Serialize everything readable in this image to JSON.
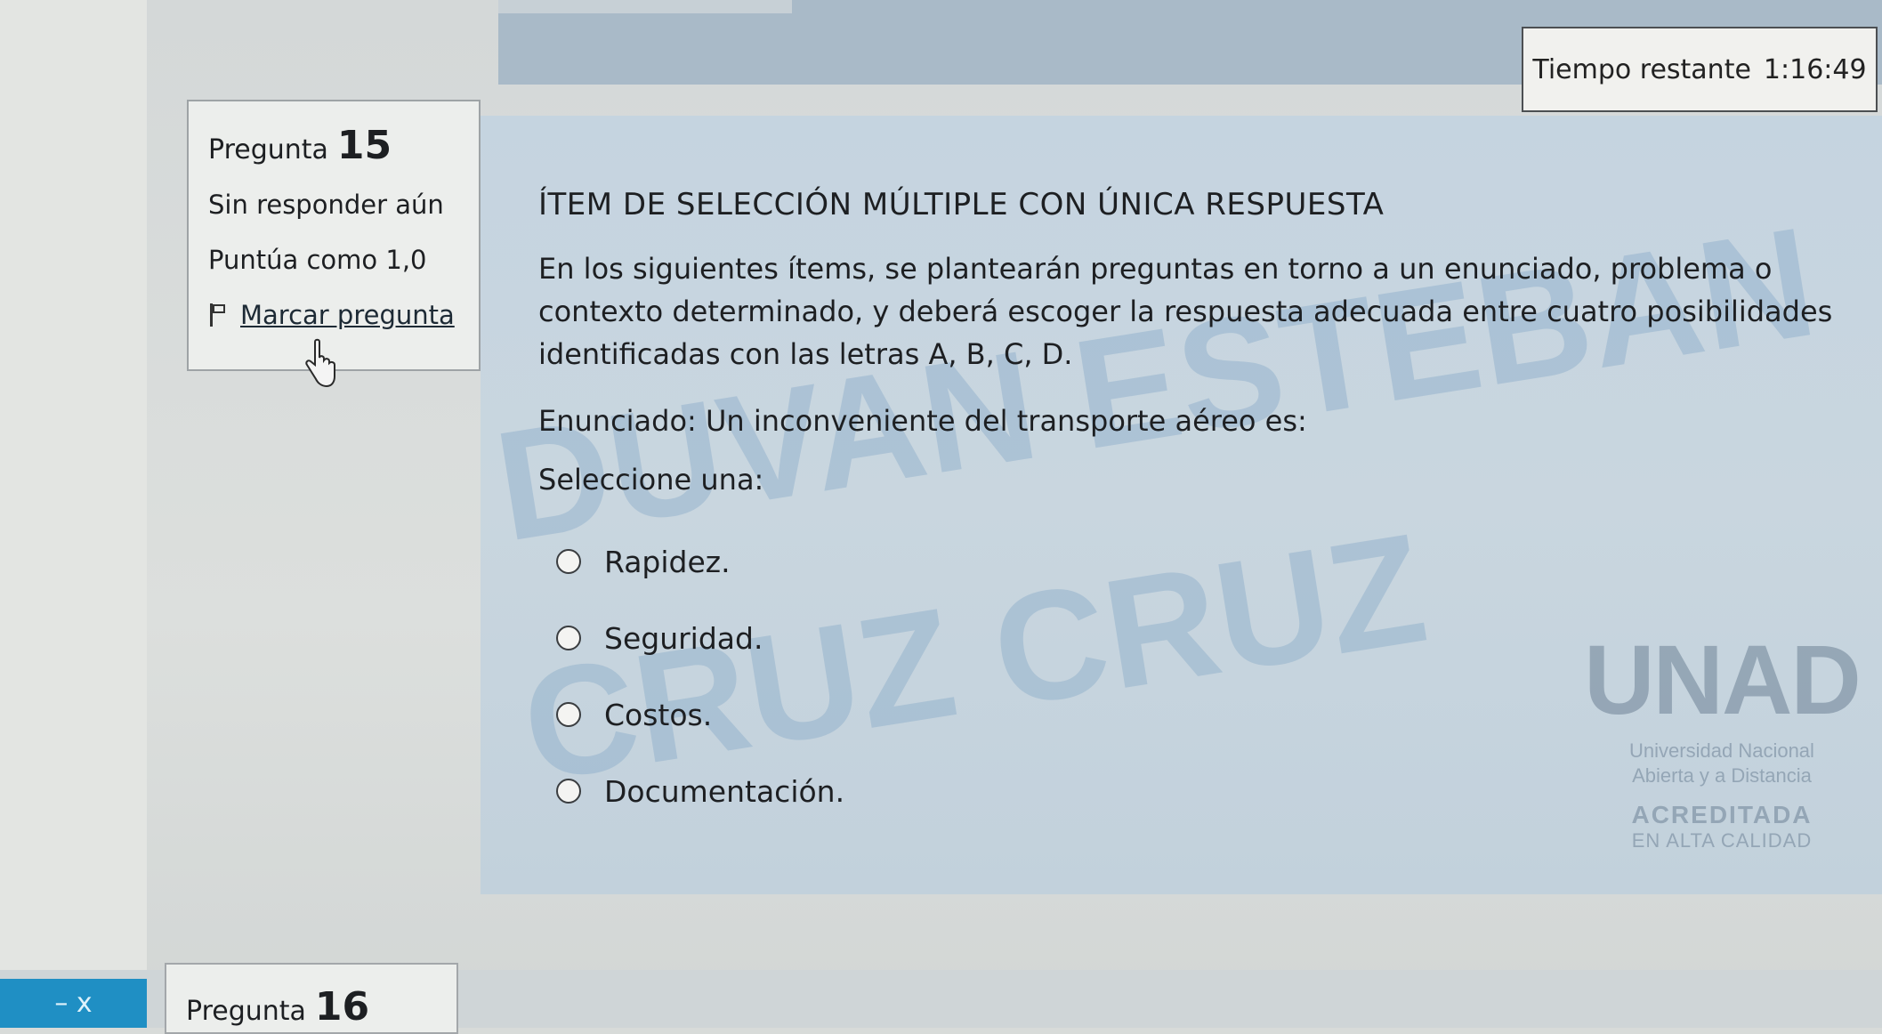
{
  "timer": {
    "label": "Tiempo restante",
    "value": "1:16:49"
  },
  "question_info": {
    "label": "Pregunta",
    "number": "15",
    "status": "Sin responder aún",
    "score": "Puntúa como 1,0",
    "flag_label": "Marcar pregunta"
  },
  "question": {
    "title": "ÍTEM DE SELECCIÓN MÚLTIPLE CON ÚNICA RESPUESTA",
    "description": "En los siguientes ítems, se plantearán preguntas en torno a un enunciado, problema o contexto determinado, y deberá escoger la respuesta adecuada entre cuatro posibilidades identificadas con las letras A, B, C, D.",
    "statement": "Enunciado: Un inconveniente del transporte aéreo es:",
    "select_prompt": "Seleccione una:",
    "options": [
      "Rapidez.",
      "Seguridad.",
      "Costos.",
      "Documentación."
    ]
  },
  "watermark": {
    "line1": "DUVAN ESTEBAN",
    "line2": "CRUZ CRUZ"
  },
  "logo": {
    "mark": "UNAD",
    "line1": "Universidad Nacional",
    "line2": "Abierta y a Distancia",
    "accredited": "ACREDITADA",
    "quality": "EN ALTA CALIDAD"
  },
  "next_question": {
    "label": "Pregunta",
    "number": "16"
  },
  "taskbar": {
    "label": "– x"
  },
  "colors": {
    "panel": "#c5d4e0",
    "info_box": "#eceeec",
    "taskbar": "#1f8fc4"
  }
}
